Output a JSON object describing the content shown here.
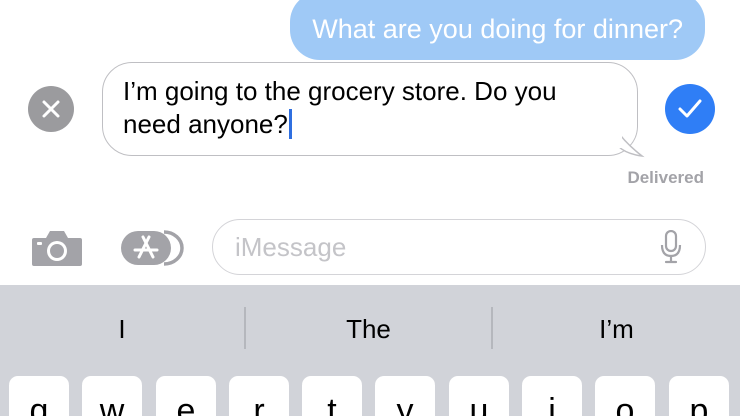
{
  "conversation": {
    "sent_message": "What are you doing for dinner?",
    "editing_text": "I’m going to the grocery store. Do you need anyone?",
    "status": "Delivered"
  },
  "compose": {
    "placeholder": "iMessage"
  },
  "keyboard": {
    "suggestions": [
      "I",
      "The",
      "I’m"
    ],
    "keys": [
      "q",
      "w",
      "e",
      "r",
      "t",
      "y",
      "u",
      "i",
      "o",
      "p"
    ]
  },
  "colors": {
    "sent_bubble": "#9fc9f6",
    "confirm": "#2f7ef6",
    "caret": "#2f6fe0",
    "keyboard_bg": "#d1d3d9"
  },
  "icons": [
    "close-icon",
    "checkmark-icon",
    "camera-icon",
    "app-store-icon",
    "microphone-icon"
  ]
}
